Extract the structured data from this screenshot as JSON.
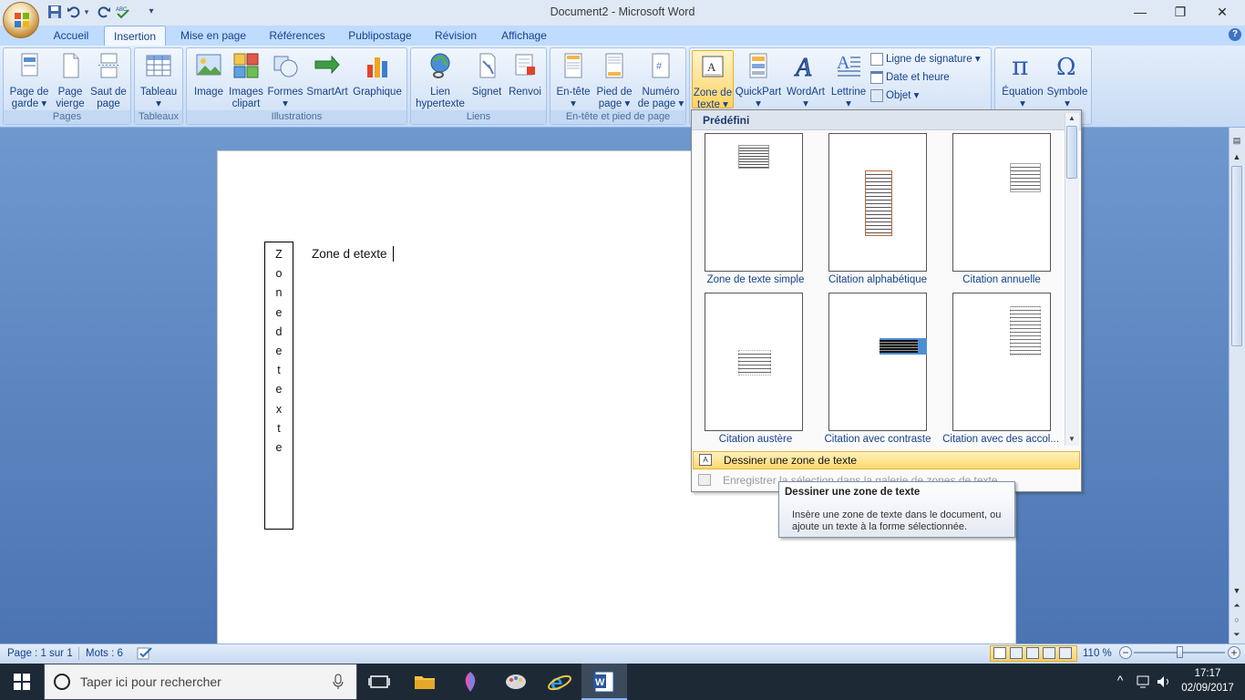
{
  "window": {
    "title": "Document2 - Microsoft Word",
    "minimize_glyph": "—",
    "restore_glyph": "❐",
    "close_glyph": "✕",
    "help_glyph": "?"
  },
  "quick_access": {
    "save_icon": "save-icon",
    "undo_icon": "undo-icon",
    "redo_icon": "redo-icon",
    "spelling_icon": "spelling-check-icon",
    "customize_glyph": "▾"
  },
  "tabs": [
    {
      "label": "Accueil"
    },
    {
      "label": "Insertion"
    },
    {
      "label": "Mise en page"
    },
    {
      "label": "Références"
    },
    {
      "label": "Publipostage"
    },
    {
      "label": "Révision"
    },
    {
      "label": "Affichage"
    }
  ],
  "ribbon": {
    "groups": {
      "pages": "Pages",
      "tableaux": "Tableaux",
      "illustrations": "Illustrations",
      "liens": "Liens",
      "entete": "En-tête et pied de page",
      "texte": "",
      "symboles": ""
    },
    "buttons": {
      "page_de_garde": [
        "Page de",
        "garde ▾"
      ],
      "page_vierge": [
        "Page",
        "vierge"
      ],
      "saut_de_page": [
        "Saut de",
        "page"
      ],
      "tableau": [
        "Tableau",
        "▾"
      ],
      "image": [
        "Image"
      ],
      "images_clipart": [
        "Images",
        "clipart"
      ],
      "formes": [
        "Formes",
        "▾"
      ],
      "smartart": [
        "SmartArt"
      ],
      "graphique": [
        "Graphique"
      ],
      "lien_hypertexte": [
        "Lien",
        "hypertexte"
      ],
      "signet": [
        "Signet"
      ],
      "renvoi": [
        "Renvoi"
      ],
      "en_tete": [
        "En-tête",
        "▾"
      ],
      "pied_de_page": [
        "Pied de",
        "page ▾"
      ],
      "numero_de_page": [
        "Numéro",
        "de page ▾"
      ],
      "zone_de_texte": [
        "Zone de",
        "texte ▾"
      ],
      "quickpart": [
        "QuickPart",
        "▾"
      ],
      "wordart": [
        "WordArt",
        "▾"
      ],
      "lettrine": [
        "Lettrine",
        "▾"
      ],
      "equation": [
        "Équation",
        "▾"
      ],
      "symbole": [
        "Symbole",
        "▾"
      ]
    },
    "small_buttons": {
      "ligne_signature": "Ligne de signature ▾",
      "date_heure": "Date et heure",
      "objet": "Objet ▾"
    }
  },
  "document": {
    "vertical_textbox_chars": [
      "Z",
      "o",
      "n",
      "e",
      "d",
      "e",
      "t",
      "e",
      "x",
      "t",
      "e"
    ],
    "body_text": "Zone d etexte"
  },
  "gallery": {
    "header": "Prédéfini",
    "items": [
      {
        "caption": "Zone de texte simple"
      },
      {
        "caption": "Citation alphabétique"
      },
      {
        "caption": "Citation annuelle"
      },
      {
        "caption": "Citation austère"
      },
      {
        "caption": "Citation avec contraste"
      },
      {
        "caption": "Citation avec des accol..."
      }
    ],
    "draw_item": "Dessiner une zone de texte",
    "save_item": "Enregistrer la sélection dans la galerie de zones de texte..."
  },
  "tooltip": {
    "title": "Dessiner une zone de texte",
    "body": "Insère une zone de texte dans le document, ou ajoute un texte à la forme sélectionnée."
  },
  "statusbar": {
    "page": "Page : 1 sur 1",
    "words": "Mots : 6",
    "zoom": "110 %",
    "zoom_minus": "−",
    "zoom_plus": "+"
  },
  "taskbar": {
    "search_placeholder": "Taper ici pour rechercher",
    "time": "17:17",
    "date": "02/09/2017",
    "tray_up_glyph": "^"
  },
  "colors": {
    "ribbon_bg": "#dbe8f8",
    "tab_bar": "#bfdbff",
    "workspace": "#5f87c1",
    "highlight": "#ffd86a",
    "taskbar": "#1d2a36"
  }
}
